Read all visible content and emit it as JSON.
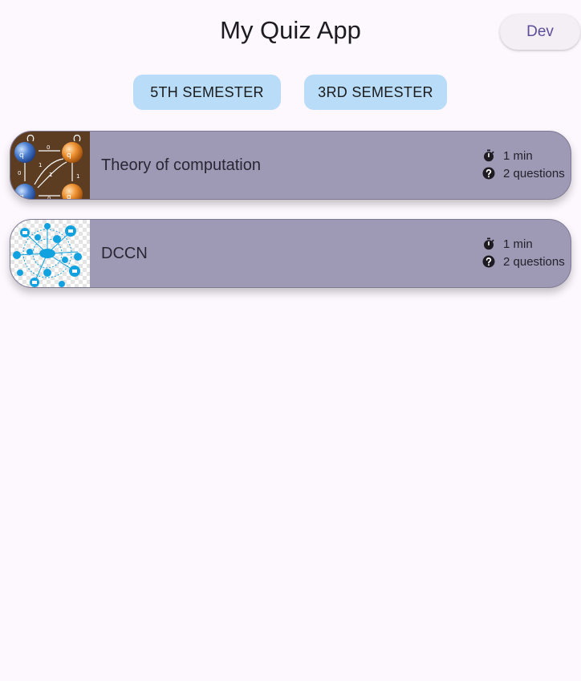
{
  "header": {
    "title": "My Quiz App",
    "dev_label": "Dev"
  },
  "semesters": [
    {
      "label": "5TH SEMESTER"
    },
    {
      "label": "3RD SEMESTER"
    }
  ],
  "quizzes": [
    {
      "title": "Theory of computation",
      "time": "1 min",
      "questions": "2 questions",
      "thumbnail": "automata-state-diagram"
    },
    {
      "title": "DCCN",
      "time": "1 min",
      "questions": "2 questions",
      "thumbnail": "network-diagram"
    }
  ],
  "colors": {
    "background": "#fdf7fe",
    "card": "#9e9ab6",
    "semester_button": "#b9dcf8",
    "dev_text": "#5b4f99"
  },
  "icons": {
    "timer": "timer-icon",
    "question": "help-circle-icon"
  }
}
